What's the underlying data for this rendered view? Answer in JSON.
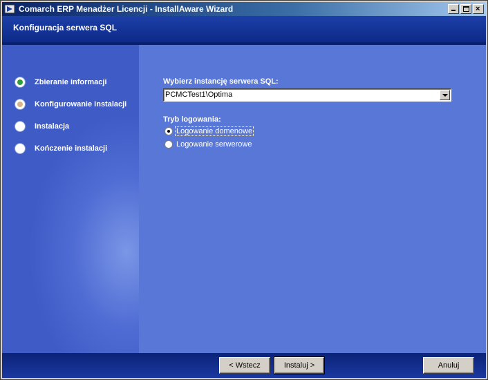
{
  "window": {
    "title": "Comarch ERP Menadżer Licencji - InstallAware Wizard",
    "buttons": {
      "minimize": "_",
      "maximize": "□",
      "close": "×"
    }
  },
  "header": {
    "title": "Konfiguracja serwera SQL"
  },
  "steps": [
    {
      "label": "Zbieranie informacji",
      "state": "current",
      "dot_color": "#2e9e3a"
    },
    {
      "label": "Konfigurowanie instalacji",
      "state": "pending",
      "dot_color": "#d9b38a"
    },
    {
      "label": "Instalacja",
      "state": "pending",
      "dot_color": ""
    },
    {
      "label": "Kończenie instalacji",
      "state": "pending",
      "dot_color": ""
    }
  ],
  "form": {
    "instance_label": "Wybierz instancję serwera SQL:",
    "instance_value": "PCMCTest1\\Optima",
    "login_mode_label": "Tryb logowania:",
    "login_options": [
      {
        "label": "Logowanie domenowe",
        "selected": true
      },
      {
        "label": "Logowanie serwerowe",
        "selected": false
      }
    ]
  },
  "footer": {
    "back": "< Wstecz",
    "install": "Instaluj >",
    "cancel": "Anuluj"
  },
  "colors": {
    "header_blue": "#0d2a88",
    "content_blue": "#5877d6",
    "current_step": "#2e9e3a",
    "next_step": "#d9b38a"
  }
}
